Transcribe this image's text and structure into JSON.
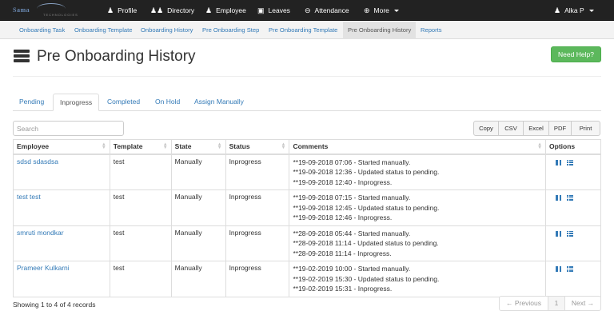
{
  "brand": {
    "text": "Sama",
    "subtext": "TECHNOLOGIES"
  },
  "topnav": {
    "items": [
      {
        "label": "Profile",
        "icon": "person-icon"
      },
      {
        "label": "Directory",
        "icon": "group-icon"
      },
      {
        "label": "Employee",
        "icon": "person-icon"
      },
      {
        "label": "Leaves",
        "icon": "camera-icon"
      },
      {
        "label": "Attendance",
        "icon": "minus-circle-icon"
      },
      {
        "label": "More",
        "icon": "plus-circle-icon"
      }
    ],
    "user": "Alka P"
  },
  "subnav": {
    "items": [
      "Onboarding Task",
      "Onboarding Template",
      "Onboarding History",
      "Pre Onboarding Step",
      "Pre Onboarding Template",
      "Pre Onboarding History",
      "Reports"
    ],
    "active": "Pre Onboarding History"
  },
  "page": {
    "title": "Pre Onboarding History",
    "help_label": "Need Help?"
  },
  "tabs": {
    "items": [
      "Pending",
      "Inprogress",
      "Completed",
      "On Hold",
      "Assign Manually"
    ],
    "active": "Inprogress"
  },
  "search": {
    "placeholder": "Search",
    "value": ""
  },
  "exports": [
    "Copy",
    "CSV",
    "Excel",
    "PDF",
    "Print"
  ],
  "table": {
    "columns": [
      "Employee",
      "Template",
      "State",
      "Status",
      "Comments",
      "Options"
    ],
    "rows": [
      {
        "employee": "sdsd sdasdsa",
        "template": "test",
        "state": "Manually",
        "status": "Inprogress",
        "comments": [
          "**19-09-2018 07:06 - Started manually.",
          "**19-09-2018 12:36 - Updated status to pending.",
          "**19-09-2018 12:40 - Inprogress."
        ]
      },
      {
        "employee": "test test",
        "template": "test",
        "state": "Manually",
        "status": "Inprogress",
        "comments": [
          "**19-09-2018 07:15 - Started manually.",
          "**19-09-2018 12:45 - Updated status to pending.",
          "**19-09-2018 12:46 - Inprogress."
        ]
      },
      {
        "employee": "smruti mondkar",
        "template": "test",
        "state": "Manually",
        "status": "Inprogress",
        "comments": [
          "**28-09-2018 05:44 - Started manually.",
          "**28-09-2018 11:14 - Updated status to pending.",
          "**28-09-2018 11:14 - Inprogress."
        ]
      },
      {
        "employee": "Prameer Kulkarni",
        "template": "test",
        "state": "Manually",
        "status": "Inprogress",
        "comments": [
          "**19-02-2019 10:00 - Started manually.",
          "**19-02-2019 15:30 - Updated status to pending.",
          "**19-02-2019 15:31 - Inprogress."
        ]
      }
    ]
  },
  "footer": {
    "info": "Showing 1 to 4 of 4 records"
  },
  "pager": {
    "prev": "← Previous",
    "page": "1",
    "next": "Next →"
  },
  "colors": {
    "link": "#337ab7",
    "navbar": "#222222",
    "help_button": "#5cb85c"
  }
}
